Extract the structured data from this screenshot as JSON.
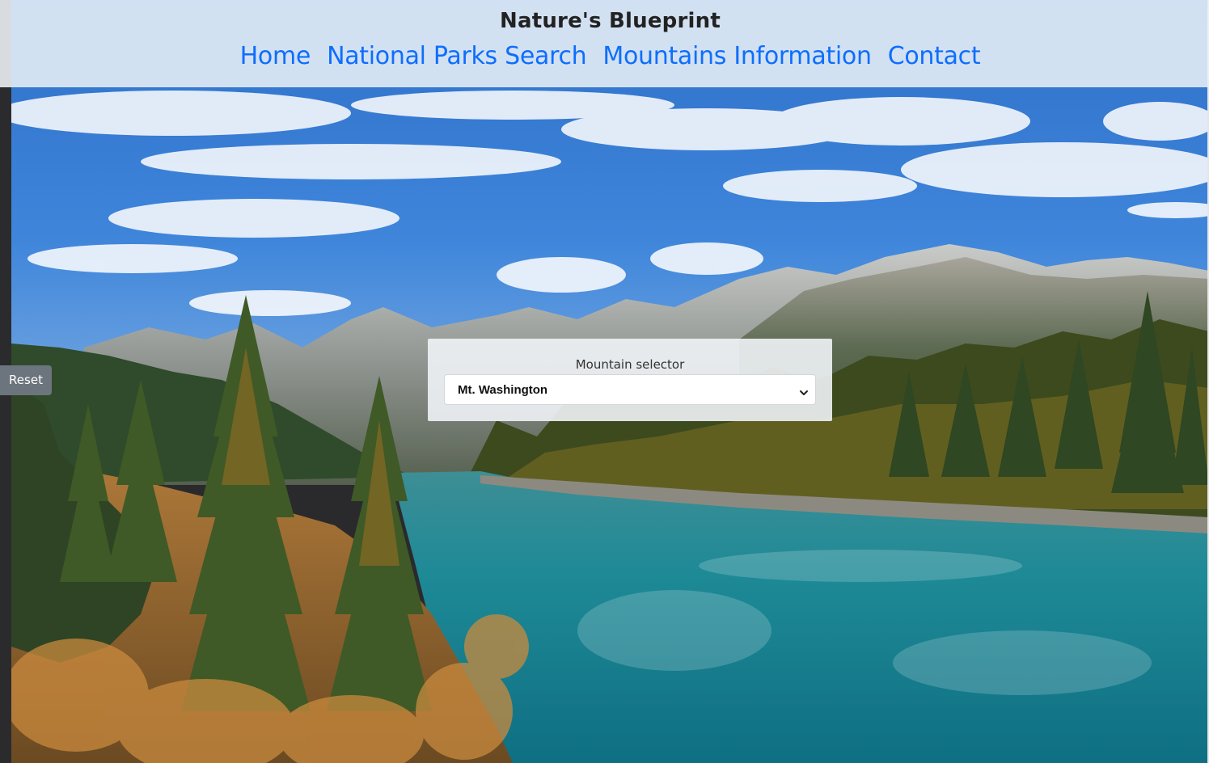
{
  "header": {
    "title": "Nature's Blueprint",
    "nav": [
      {
        "label": "Home"
      },
      {
        "label": "National Parks Search"
      },
      {
        "label": "Mountains Information"
      },
      {
        "label": "Contact"
      }
    ]
  },
  "selector": {
    "label": "Mountain selector",
    "selected": "Mt. Washington"
  },
  "reset_button": {
    "label": "Reset"
  },
  "colors": {
    "nav_link": "#0d6efd",
    "reset_bg": "#6c757d"
  }
}
